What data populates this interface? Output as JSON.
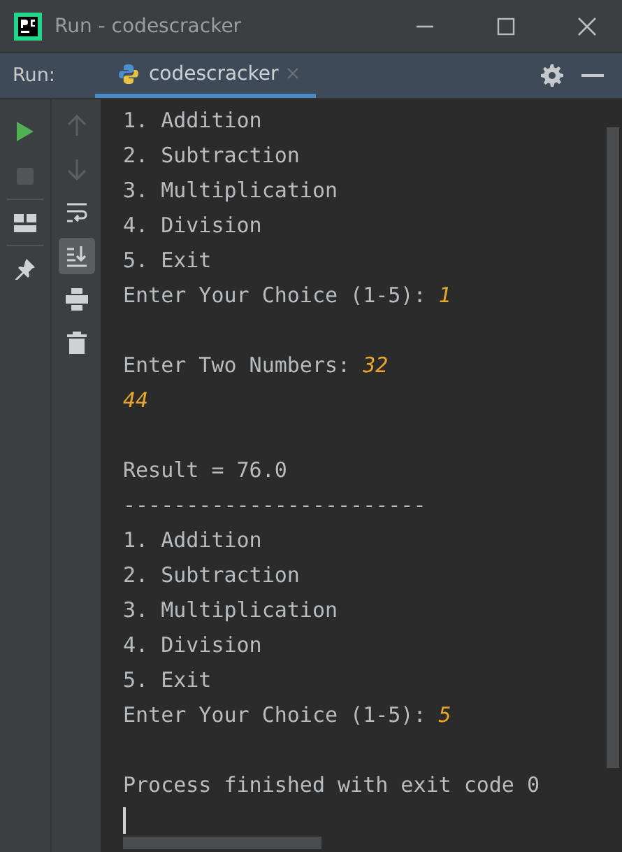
{
  "window": {
    "title": "Run - codescracker",
    "controls": [
      {
        "kind": "minimize"
      },
      {
        "kind": "maximize"
      },
      {
        "kind": "close"
      }
    ]
  },
  "run_bar": {
    "label": "Run:",
    "tabs": [
      {
        "label": "codescracker",
        "selected": true,
        "closable": true
      }
    ],
    "actions": [
      {
        "kind": "settings"
      },
      {
        "kind": "hide"
      }
    ]
  },
  "left_toolbar": [
    {
      "kind": "run",
      "disabled": false
    },
    {
      "kind": "stop",
      "disabled": true
    },
    {
      "kind": "separator"
    },
    {
      "kind": "layout",
      "disabled": false
    },
    {
      "kind": "separator"
    },
    {
      "kind": "pin",
      "disabled": false
    }
  ],
  "console_toolbar": [
    {
      "kind": "up",
      "disabled": true,
      "on": false
    },
    {
      "kind": "down",
      "disabled": true,
      "on": false
    },
    {
      "kind": "wrap",
      "disabled": false,
      "on": false
    },
    {
      "kind": "scroll-end",
      "disabled": false,
      "on": true
    },
    {
      "kind": "print",
      "disabled": false,
      "on": false
    },
    {
      "kind": "trash",
      "disabled": false,
      "on": false
    }
  ],
  "console": {
    "lines": [
      {
        "kind": "output",
        "text": "1. Addition"
      },
      {
        "kind": "output",
        "text": "2. Subtraction"
      },
      {
        "kind": "output",
        "text": "3. Multiplication"
      },
      {
        "kind": "output",
        "text": "4. Division"
      },
      {
        "kind": "output",
        "text": "5. Exit"
      },
      {
        "kind": "prompt",
        "text": "Enter Your Choice (1-5): ",
        "input": "1"
      },
      {
        "kind": "blank"
      },
      {
        "kind": "prompt",
        "text": "Enter Two Numbers: ",
        "input": "32"
      },
      {
        "kind": "input",
        "input": "44"
      },
      {
        "kind": "blank"
      },
      {
        "kind": "output",
        "text": "Result = 76.0"
      },
      {
        "kind": "output",
        "text": "------------------------"
      },
      {
        "kind": "output",
        "text": "1. Addition"
      },
      {
        "kind": "output",
        "text": "2. Subtraction"
      },
      {
        "kind": "output",
        "text": "3. Multiplication"
      },
      {
        "kind": "output",
        "text": "4. Division"
      },
      {
        "kind": "output",
        "text": "5. Exit"
      },
      {
        "kind": "prompt",
        "text": "Enter Your Choice (1-5): ",
        "input": "5"
      },
      {
        "kind": "blank"
      },
      {
        "kind": "output",
        "text": "Process finished with exit code 0"
      },
      {
        "kind": "cursor"
      }
    ]
  }
}
